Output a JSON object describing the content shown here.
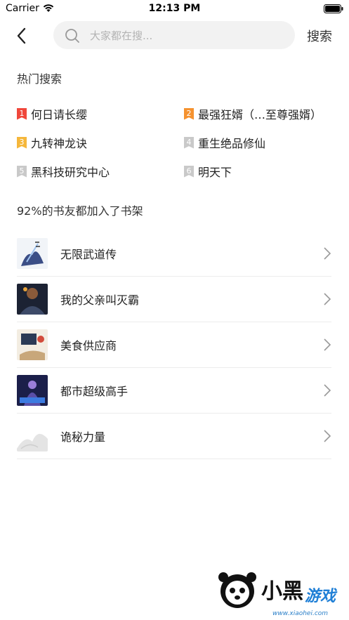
{
  "status_bar": {
    "carrier": "Carrier",
    "time": "12:13 PM"
  },
  "search": {
    "placeholder": "大家都在搜...",
    "submit_label": "搜索"
  },
  "hot_search": {
    "title": "热门搜索",
    "items": [
      {
        "rank": "1",
        "label": "何日请长缨",
        "badge_color": "#f0473b"
      },
      {
        "rank": "2",
        "label": "最强狂婿（…至尊强婿）",
        "badge_color": "#f5922f"
      },
      {
        "rank": "3",
        "label": "九转神龙诀",
        "badge_color": "#f5b73b"
      },
      {
        "rank": "4",
        "label": "重生绝品修仙",
        "badge_color": "#c9c9c9"
      },
      {
        "rank": "5",
        "label": "黑科技研究中心",
        "badge_color": "#c9c9c9"
      },
      {
        "rank": "6",
        "label": "明天下",
        "badge_color": "#c9c9c9"
      }
    ]
  },
  "bookshelf": {
    "title": "92%的书友都加入了书架",
    "books": [
      {
        "title": "无限武道传"
      },
      {
        "title": "我的父亲叫灭霸"
      },
      {
        "title": "美食供应商"
      },
      {
        "title": "都市超级高手"
      },
      {
        "title": "诡秘力量"
      }
    ]
  },
  "watermark": {
    "brand": "小黑游戏",
    "url": "www.xiaohei.com"
  }
}
